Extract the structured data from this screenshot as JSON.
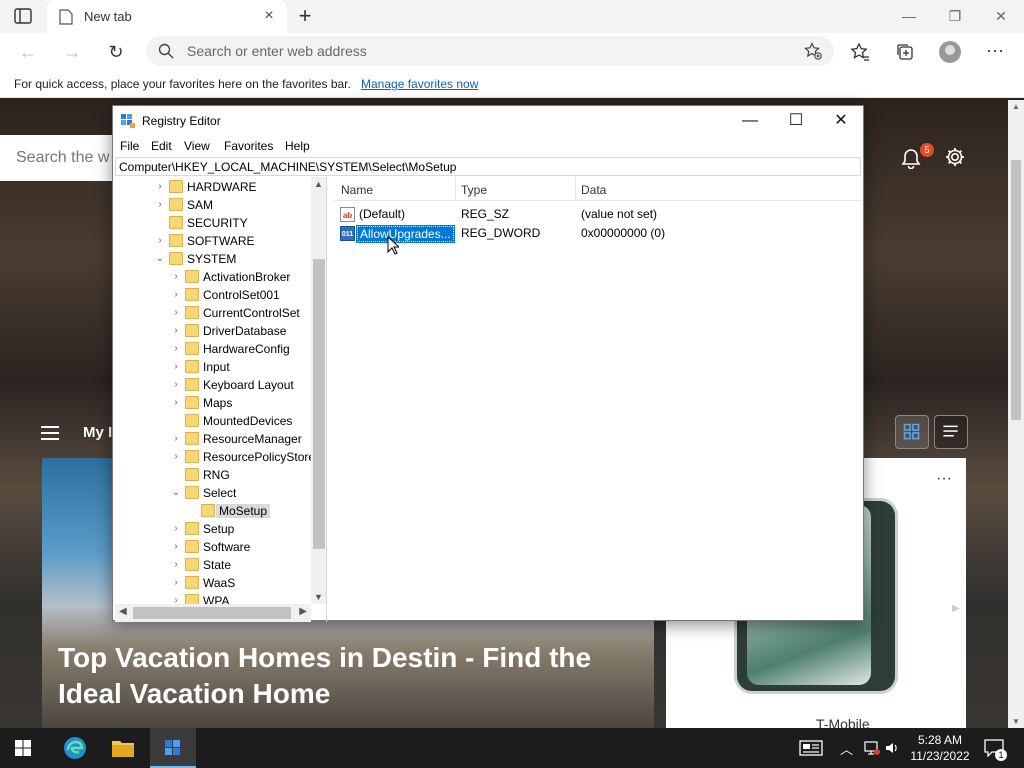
{
  "browser": {
    "tab_title": "New tab",
    "address_placeholder": "Search or enter web address",
    "favbar_message": "For quick access, place your favorites here on the favorites bar.",
    "favbar_link": "Manage favorites now"
  },
  "newtab_page": {
    "search_placeholder": "Search the w",
    "notification_count": "5",
    "feed_label": "My I",
    "headline": "Top Vacation Homes in Destin - Find the Ideal Vacation Home",
    "side_card_brand": "T-Mobile",
    "side_card_more": "···"
  },
  "regedit": {
    "title": "Registry Editor",
    "menu": [
      "File",
      "Edit",
      "View",
      "Favorites",
      "Help"
    ],
    "address": "Computer\\HKEY_LOCAL_MACHINE\\SYSTEM\\Select\\MoSetup",
    "tree": [
      {
        "label": "HARDWARE",
        "depth": 0,
        "chev": "›"
      },
      {
        "label": "SAM",
        "depth": 0,
        "chev": "›"
      },
      {
        "label": "SECURITY",
        "depth": 0,
        "chev": ""
      },
      {
        "label": "SOFTWARE",
        "depth": 0,
        "chev": "›"
      },
      {
        "label": "SYSTEM",
        "depth": 0,
        "chev": "⌄"
      },
      {
        "label": "ActivationBroker",
        "depth": 1,
        "chev": "›"
      },
      {
        "label": "ControlSet001",
        "depth": 1,
        "chev": "›"
      },
      {
        "label": "CurrentControlSet",
        "depth": 1,
        "chev": "›"
      },
      {
        "label": "DriverDatabase",
        "depth": 1,
        "chev": "›"
      },
      {
        "label": "HardwareConfig",
        "depth": 1,
        "chev": "›"
      },
      {
        "label": "Input",
        "depth": 1,
        "chev": "›"
      },
      {
        "label": "Keyboard Layout",
        "depth": 1,
        "chev": "›"
      },
      {
        "label": "Maps",
        "depth": 1,
        "chev": "›"
      },
      {
        "label": "MountedDevices",
        "depth": 1,
        "chev": ""
      },
      {
        "label": "ResourceManager",
        "depth": 1,
        "chev": "›"
      },
      {
        "label": "ResourcePolicyStore",
        "depth": 1,
        "chev": "›"
      },
      {
        "label": "RNG",
        "depth": 1,
        "chev": ""
      },
      {
        "label": "Select",
        "depth": 1,
        "chev": "⌄"
      },
      {
        "label": "MoSetup",
        "depth": 2,
        "chev": "",
        "selected": true
      },
      {
        "label": "Setup",
        "depth": 1,
        "chev": "›"
      },
      {
        "label": "Software",
        "depth": 1,
        "chev": "›"
      },
      {
        "label": "State",
        "depth": 1,
        "chev": "›"
      },
      {
        "label": "WaaS",
        "depth": 1,
        "chev": "›"
      },
      {
        "label": "WPA",
        "depth": 1,
        "chev": "›"
      }
    ],
    "columns": {
      "name": "Name",
      "type": "Type",
      "data": "Data"
    },
    "values": [
      {
        "icon": "ab",
        "name": "(Default)",
        "type": "REG_SZ",
        "data": "(value not set)",
        "selected": false
      },
      {
        "icon": "011",
        "name": "AllowUpgrades...",
        "type": "REG_DWORD",
        "data": "0x00000000 (0)",
        "selected": true
      }
    ]
  },
  "taskbar": {
    "time": "5:28 AM",
    "date": "11/23/2022",
    "notification_count": "1"
  },
  "colors": {
    "accent": "#0078d7",
    "taskbar": "#1c1c1c",
    "folder": "#f8d775",
    "link": "#0b62b8"
  }
}
